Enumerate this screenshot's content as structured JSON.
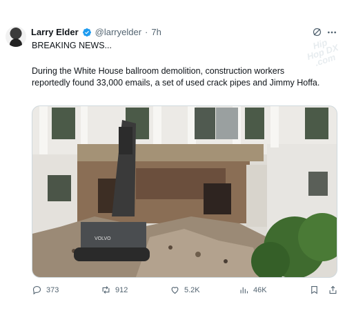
{
  "tweet": {
    "author": {
      "display_name": "Larry Elder",
      "handle": "@larryelder",
      "separator": "·",
      "time": "7h",
      "verified_color": "#1d9bf0"
    },
    "watermark": "Hip Hop DX .com",
    "headline": "BREAKING NEWS...",
    "body": "During the White House ballroom demolition, construction workers reportedly found 33,000 emails, a set of used crack pipes and Jimmy Hoffa.",
    "media": {
      "excavator_brand": "VOLVO"
    },
    "actions": {
      "replies": "373",
      "reposts": "912",
      "likes": "5.2K",
      "views": "46K"
    },
    "icons": [
      "grok-icon",
      "more-icon",
      "reply-icon",
      "repost-icon",
      "like-icon",
      "views-icon",
      "bookmark-icon",
      "share-icon"
    ]
  }
}
